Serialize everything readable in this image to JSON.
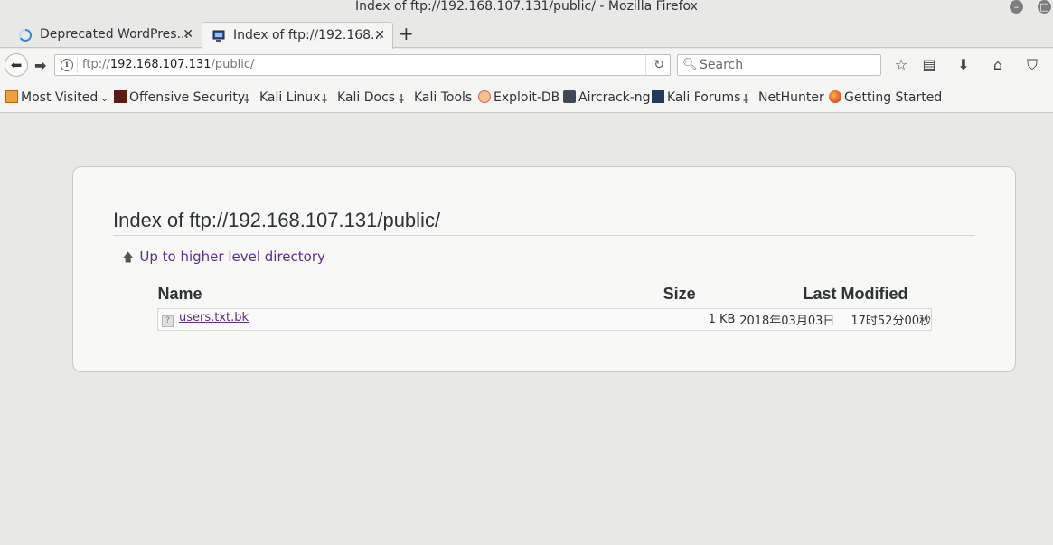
{
  "window": {
    "title": "Index of ftp://192.168.107.131/public/ - Mozilla Firefox"
  },
  "tabs": [
    {
      "label": "Deprecated WordPres...",
      "loading": true
    },
    {
      "label": "Index of ftp://192.168...",
      "active": true
    }
  ],
  "toolbar": {
    "url_scheme": "ftp://",
    "url_host": "192.168.107.131",
    "url_path": "/public/",
    "search_placeholder": "Search"
  },
  "bookmarks": [
    {
      "label": "Most Visited",
      "icon": "folder-gear-icon",
      "dropdown": true
    },
    {
      "label": "Offensive Security",
      "icon": "offsec-icon"
    },
    {
      "label": "Kali Linux",
      "icon": "kali-dragon-icon"
    },
    {
      "label": "Kali Docs",
      "icon": "kali-dragon-icon"
    },
    {
      "label": "Kali Tools",
      "icon": "kali-dragon-icon"
    },
    {
      "label": "Exploit-DB",
      "icon": "exploitdb-icon"
    },
    {
      "label": "Aircrack-ng",
      "icon": "aircrack-icon"
    },
    {
      "label": "Kali Forums",
      "icon": "kali-forums-icon"
    },
    {
      "label": "NetHunter",
      "icon": "kali-dragon-icon"
    },
    {
      "label": "Getting Started",
      "icon": "firefox-icon"
    }
  ],
  "page": {
    "heading": "Index of ftp://192.168.107.131/public/",
    "up_link": "Up to higher level directory",
    "columns": {
      "name": "Name",
      "size": "Size",
      "modified": "Last Modified"
    },
    "files": [
      {
        "name": "users.txt.bk",
        "size": "1 KB",
        "date": "2018年03月03日",
        "time": "17时52分00秒"
      }
    ]
  },
  "colors": {
    "chrome_bg": "#e8e8e7",
    "toolbar_bg": "#f5f5f4",
    "link_visited": "#5b2f8c"
  }
}
